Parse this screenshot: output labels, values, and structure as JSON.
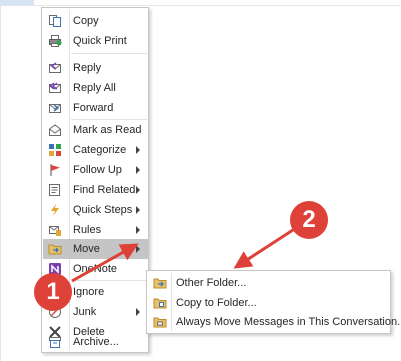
{
  "context_menu": {
    "items": [
      {
        "label": "Copy",
        "icon": "copy-icon",
        "submenu": false
      },
      {
        "label": "Quick Print",
        "icon": "printer-icon",
        "submenu": false
      },
      {
        "label": "Reply",
        "icon": "reply-icon",
        "submenu": false
      },
      {
        "label": "Reply All",
        "icon": "reply-all-icon",
        "submenu": false
      },
      {
        "label": "Forward",
        "icon": "forward-icon",
        "submenu": false
      },
      {
        "label": "Mark as Read",
        "icon": "envelope-open-icon",
        "submenu": false
      },
      {
        "label": "Categorize",
        "icon": "categorize-icon",
        "submenu": true
      },
      {
        "label": "Follow Up",
        "icon": "flag-icon",
        "submenu": true
      },
      {
        "label": "Find Related",
        "icon": "find-related-icon",
        "submenu": true
      },
      {
        "label": "Quick Steps",
        "icon": "lightning-icon",
        "submenu": true
      },
      {
        "label": "Rules",
        "icon": "rules-icon",
        "submenu": true
      },
      {
        "label": "Move",
        "icon": "folder-move-icon",
        "submenu": true,
        "highlighted": true
      },
      {
        "label": "OneNote",
        "icon": "onenote-icon",
        "submenu": false
      },
      {
        "label": "Ignore",
        "icon": "ignore-icon",
        "submenu": false
      },
      {
        "label": "Junk",
        "icon": "junk-icon",
        "submenu": true
      },
      {
        "label": "Delete",
        "icon": "delete-x-icon",
        "submenu": false
      },
      {
        "label": "Archive...",
        "icon": "archive-icon",
        "submenu": false
      }
    ]
  },
  "move_submenu": {
    "items": [
      {
        "label": "Other Folder...",
        "icon": "other-folder-icon"
      },
      {
        "label": "Copy to Folder...",
        "icon": "copy-folder-icon"
      },
      {
        "label": "Always Move Messages in This Conversation...",
        "icon": "always-move-icon"
      }
    ]
  },
  "callouts": {
    "one": "1",
    "two": "2"
  },
  "colors": {
    "highlight": "#c5c5c5",
    "callout": "#dd4137",
    "topbar_selection": "#d5e3f3"
  }
}
